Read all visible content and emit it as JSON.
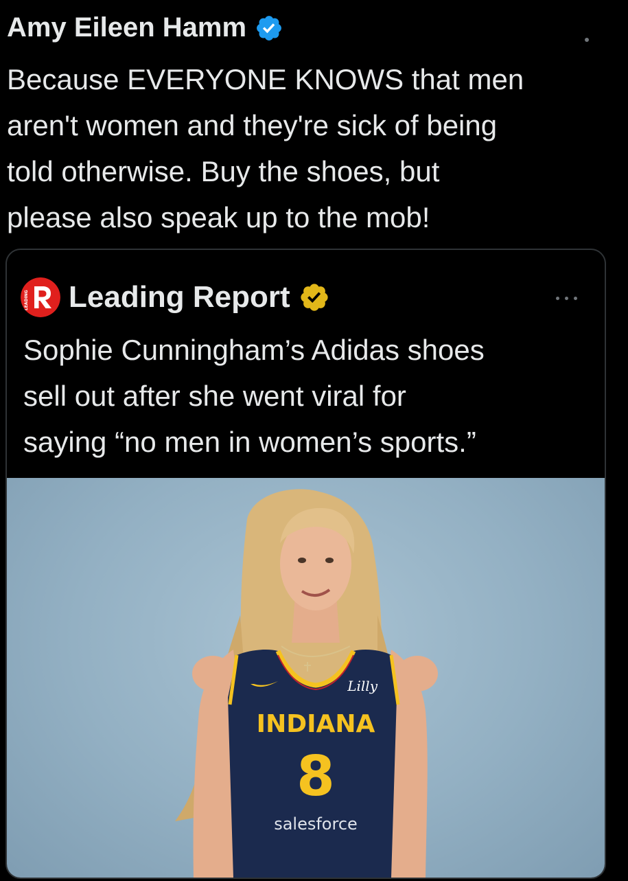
{
  "tweet": {
    "author_name": "Amy Eileen Hamm",
    "verified_icon": "verified-badge-icon",
    "text_lines": [
      "Because EVERYONE KNOWS that men",
      "aren't women and they're sick of being",
      "told otherwise. Buy the shoes, but",
      "please also speak up to the mob!"
    ]
  },
  "quote": {
    "author_name": "Leading Report",
    "avatar_icon": "leading-report-logo",
    "badge_icon": "gold-verified-badge-icon",
    "text_lines": [
      "Sophie Cunningham’s Adidas shoes",
      "sell out after she went viral for",
      "saying “no men in women’s sports.”"
    ],
    "image": {
      "jersey_team": "INDIANA",
      "jersey_number": "8",
      "jersey_sponsor_top": "Lilly",
      "jersey_sponsor_bottom": "salesforce",
      "avatar_logo_text": "LEADING"
    }
  },
  "colors": {
    "background": "#000000",
    "text": "#e7e9ea",
    "verified_blue": "#1d9bf0",
    "gold_badge": "#e2b719",
    "avatar_red": "#e0201d",
    "card_border": "#2f3336",
    "photo_backdrop": "#a2bccd",
    "jersey_navy": "#1b2a4e",
    "jersey_gold": "#f5c220"
  }
}
